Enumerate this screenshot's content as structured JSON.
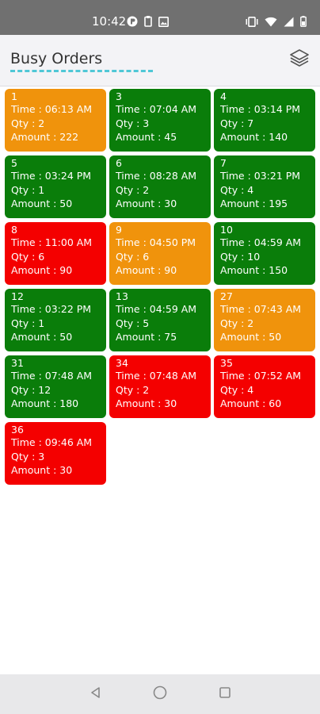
{
  "status_bar": {
    "time": "10:42"
  },
  "app_bar": {
    "title": "Busy Orders",
    "menu_icon": "layers-icon"
  },
  "colors": {
    "green": "#0a7d0a",
    "orange": "#f0930c",
    "red": "#f40000"
  },
  "orders": [
    {
      "number": "1",
      "time": "Time : 06:13 AM",
      "qty": "Qty : 2",
      "amount": "Amount : 222",
      "status": "orange"
    },
    {
      "number": "3",
      "time": "Time : 07:04 AM",
      "qty": "Qty : 3",
      "amount": "Amount : 45",
      "status": "green"
    },
    {
      "number": "4",
      "time": "Time : 03:14 PM",
      "qty": "Qty : 7",
      "amount": "Amount : 140",
      "status": "green"
    },
    {
      "number": "5",
      "time": "Time : 03:24 PM",
      "qty": "Qty : 1",
      "amount": "Amount : 50",
      "status": "green"
    },
    {
      "number": "6",
      "time": "Time : 08:28 AM",
      "qty": "Qty : 2",
      "amount": "Amount : 30",
      "status": "green"
    },
    {
      "number": "7",
      "time": "Time : 03:21 PM",
      "qty": "Qty : 4",
      "amount": "Amount : 195",
      "status": "green"
    },
    {
      "number": "8",
      "time": "Time : 11:00 AM",
      "qty": "Qty : 6",
      "amount": "Amount : 90",
      "status": "red"
    },
    {
      "number": "9",
      "time": "Time : 04:50 PM",
      "qty": "Qty : 6",
      "amount": "Amount : 90",
      "status": "orange"
    },
    {
      "number": "10",
      "time": "Time : 04:59 AM",
      "qty": "Qty : 10",
      "amount": "Amount : 150",
      "status": "green"
    },
    {
      "number": "12",
      "time": "Time : 03:22 PM",
      "qty": "Qty : 1",
      "amount": "Amount : 50",
      "status": "green"
    },
    {
      "number": "13",
      "time": "Time : 04:59 AM",
      "qty": "Qty : 5",
      "amount": "Amount : 75",
      "status": "green"
    },
    {
      "number": "27",
      "time": "Time : 07:43 AM",
      "qty": "Qty : 2",
      "amount": "Amount : 50",
      "status": "orange"
    },
    {
      "number": "31",
      "time": "Time : 07:48 AM",
      "qty": "Qty : 12",
      "amount": "Amount : 180",
      "status": "green"
    },
    {
      "number": "34",
      "time": "Time : 07:48 AM",
      "qty": "Qty : 2",
      "amount": "Amount : 30",
      "status": "red"
    },
    {
      "number": "35",
      "time": "Time : 07:52 AM",
      "qty": "Qty : 4",
      "amount": "Amount : 60",
      "status": "red"
    },
    {
      "number": "36",
      "time": "Time : 09:46 AM",
      "qty": "Qty : 3",
      "amount": "Amount : 30",
      "status": "red"
    }
  ],
  "nav_bar": {
    "back_icon": "back-triangle-icon",
    "home_icon": "home-circle-icon",
    "recents_icon": "recents-square-icon"
  }
}
